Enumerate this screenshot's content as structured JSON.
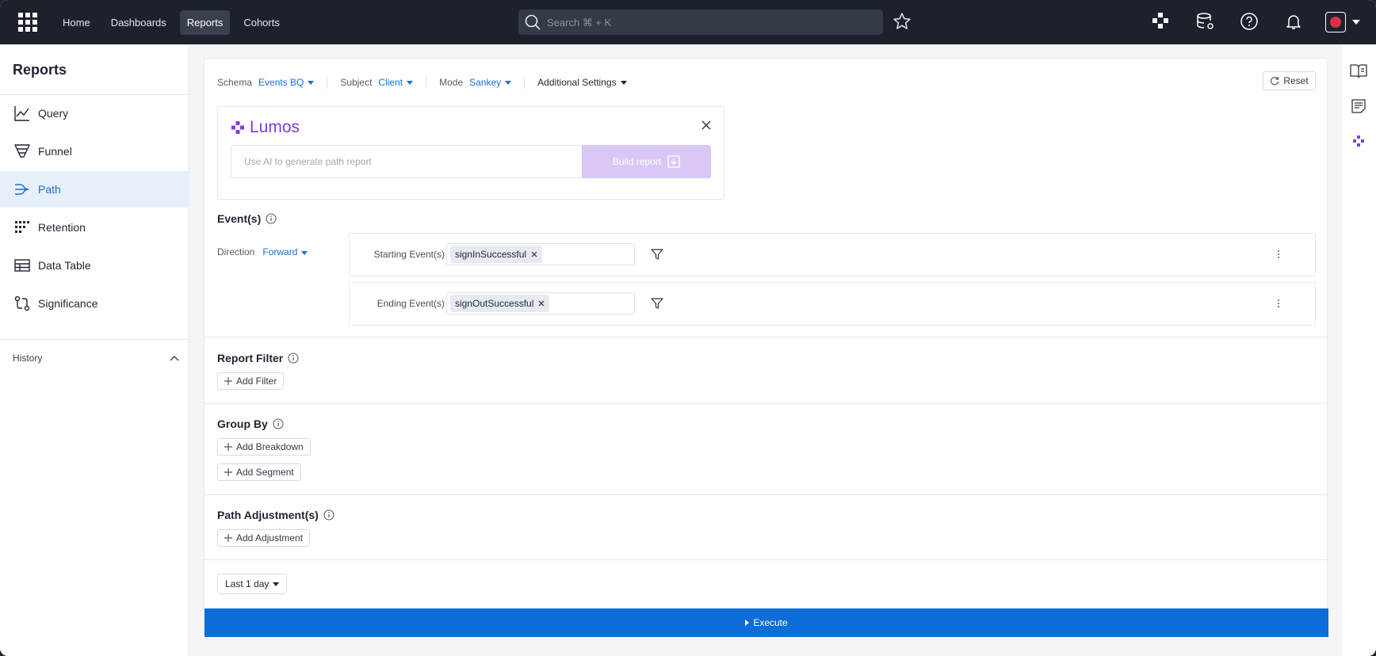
{
  "topnav": {
    "items": [
      "Home",
      "Dashboards",
      "Reports",
      "Cohorts"
    ],
    "active": "Reports",
    "search_placeholder": "Search ⌘ + K"
  },
  "sidebar": {
    "title": "Reports",
    "items": [
      {
        "label": "Query",
        "icon": "line-chart-icon"
      },
      {
        "label": "Funnel",
        "icon": "funnel-icon"
      },
      {
        "label": "Path",
        "icon": "path-icon"
      },
      {
        "label": "Retention",
        "icon": "retention-grid-icon"
      },
      {
        "label": "Data Table",
        "icon": "table-icon"
      },
      {
        "label": "Significance",
        "icon": "significance-icon"
      }
    ],
    "active": "Path",
    "history_label": "History"
  },
  "settings": {
    "schema_label": "Schema",
    "schema_value": "Events BQ",
    "subject_label": "Subject",
    "subject_value": "Client",
    "mode_label": "Mode",
    "mode_value": "Sankey",
    "additional_label": "Additional Settings",
    "reset_label": "Reset"
  },
  "lumos": {
    "title": "Lumos",
    "input_placeholder": "Use AI to generate path report",
    "build_label": "Build report"
  },
  "events": {
    "title": "Event(s)",
    "direction_label": "Direction",
    "direction_value": "Forward",
    "rows": [
      {
        "label": "Starting Event(s)",
        "chip": "signInSuccessful"
      },
      {
        "label": "Ending Event(s)",
        "chip": "signOutSuccessful"
      }
    ]
  },
  "report_filter": {
    "title": "Report Filter",
    "add_label": "Add Filter"
  },
  "group_by": {
    "title": "Group By",
    "add_breakdown": "Add Breakdown",
    "add_segment": "Add Segment"
  },
  "path_adjustment": {
    "title": "Path Adjustment(s)",
    "add_label": "Add Adjustment"
  },
  "date_range": "Last 1 day",
  "execute_label": "Execute",
  "colors": {
    "accent": "#1a6fd1",
    "lumos": "#7b3fe4",
    "execute": "#0c6dd8",
    "topbar": "#1c212c"
  }
}
